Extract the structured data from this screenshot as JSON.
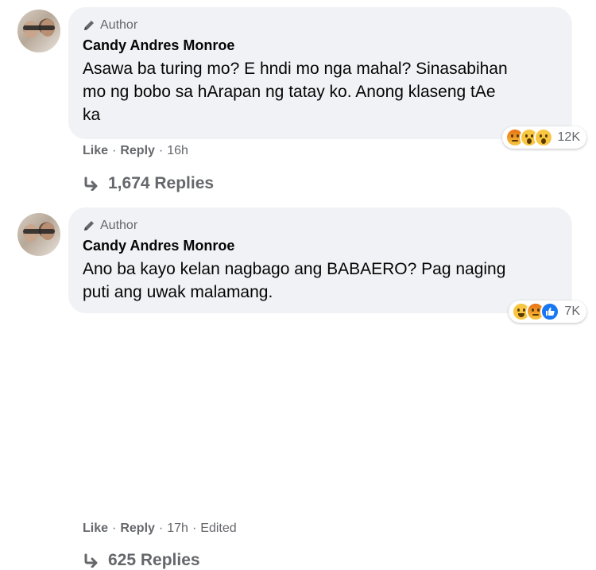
{
  "comments": [
    {
      "author_badge": "Author",
      "name": "Candy Andres Monroe",
      "text_lines": [
        "Asawa ba turing mo? E hndi mo nga mahal? Sinasabihan",
        "mo ng bobo sa hArapan ng tatay ko. Anong klaseng tAe",
        "ka"
      ],
      "reactions": [
        "angry-icon",
        "wow-icon",
        "wow-icon"
      ],
      "reaction_count": "12K",
      "like_label": "Like",
      "reply_label": "Reply",
      "time": "16h",
      "edited": "",
      "replies_label": "1,674 Replies"
    },
    {
      "author_badge": "Author",
      "name": "Candy Andres Monroe",
      "text_lines": [
        "Ano ba kayo kelan nagbago ang BABAERO? Pag naging",
        "puti ang uwak malamang."
      ],
      "reactions": [
        "haha-icon",
        "angry-icon",
        "like-icon"
      ],
      "reaction_count": "7K",
      "like_label": "Like",
      "reply_label": "Reply",
      "time": "17h",
      "edited": "Edited",
      "replies_label": "625 Replies"
    }
  ],
  "sep": "·"
}
